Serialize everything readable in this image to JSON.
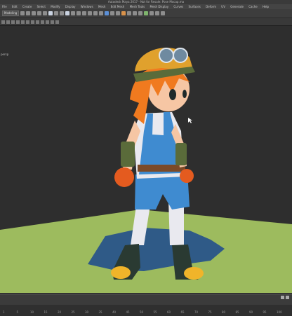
{
  "window": {
    "title": "Autodesk Maya 2017 - Not for Resale: Pose Mocap.ma"
  },
  "menu": [
    "File",
    "Edit",
    "Create",
    "Select",
    "Modify",
    "Display",
    "Windows",
    "Mesh",
    "Edit Mesh",
    "Mesh Tools",
    "Mesh Display",
    "Curves",
    "Surfaces",
    "Deform",
    "UV",
    "Generate",
    "Cache",
    "Help"
  ],
  "shelf": {
    "mode": "Modeling"
  },
  "viewport": {
    "camera_label": "persp"
  },
  "timeline": {
    "ticks": [
      "1",
      "5",
      "10",
      "15",
      "20",
      "25",
      "30",
      "35",
      "40",
      "45",
      "50",
      "55",
      "60",
      "65",
      "70",
      "75",
      "80",
      "85",
      "90",
      "95",
      "100"
    ]
  },
  "colors": {
    "viewport_bg": "#2e2e2e",
    "ground": "#9dbb5e",
    "shadow": "#2f5a87",
    "hair": "#f07a1f",
    "overalls": "#3f8bd0",
    "helmet": "#e0a12d"
  }
}
